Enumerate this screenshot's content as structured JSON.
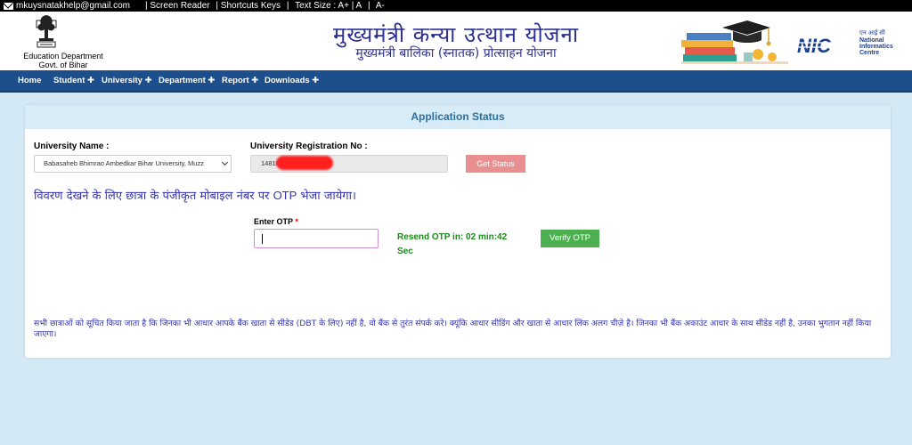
{
  "topbar": {
    "email": "mkuysnatakhelp@gmail.com",
    "links": [
      "| Screen Reader",
      "| Shortcuts Keys",
      "|",
      "Text Size : A+ | A",
      "|",
      "A-"
    ]
  },
  "header": {
    "dept_line1": "Education Department",
    "dept_line2": "Govt. of Bihar",
    "title": "मुख्यमंत्री कन्या उत्थान योजना",
    "subtitle": "मुख्यमंत्री बालिका (स्नातक) प्रोत्साहन योजना",
    "nic_hindi": "एन आई सी",
    "nic_line1": "National",
    "nic_line2": "Informatics",
    "nic_line3": "Centre",
    "nic_logo_text": "NIC"
  },
  "nav": {
    "items": [
      "Home",
      "Student ✚",
      "University ✚",
      "Department ✚",
      "Report ✚",
      "Downloads ✚"
    ]
  },
  "panel": {
    "heading": "Application Status",
    "university_label": "University Name :",
    "university_value": "Babasaheb Bhimrao Ambedkar Bihar University, Muzz",
    "registration_label": "University Registration No :",
    "registration_value": "14810",
    "get_status_label": "Get Status",
    "info_message_pre": "विवरण देखने के लिए छात्रा के पंजीकृत मोबाइल नंबर पर ",
    "info_message_otp": "OTP",
    "info_message_post": " भेजा जायेगा।",
    "otp_label": "Enter OTP",
    "otp_required": "*",
    "otp_value": "",
    "resend_line1": "Resend OTP in: 02 min:42",
    "resend_line2": "Sec",
    "verify_label": "Verify OTP",
    "notice": "सभी छात्राओं को सूचित किया जाता है कि जिनका भी आधार आपके बैंक खाता से सीडेड (DBT के लिए) नहीं है, वो बैंक से तुरंत संपर्क करे। क्यूंकि आधार सीडिंग और खाता से आधार लिंक अलग चीज़े है। जिनका भी बैंक अकाउंट आधार के साथ सीडेड नहीं है, उनका भुगतान नहीं किया जाएगा।"
  },
  "colors": {
    "topbar_bg": "#000000",
    "nav_bg": "#1c4f8c",
    "page_bg": "#d4e9f6",
    "title_color": "#2d3092",
    "heading_color": "#2f6f9e",
    "get_status_bg": "#ea8f8f",
    "verify_bg": "#4cb050",
    "timer_color": "#1a8a1a",
    "message_color": "#3333b0"
  }
}
